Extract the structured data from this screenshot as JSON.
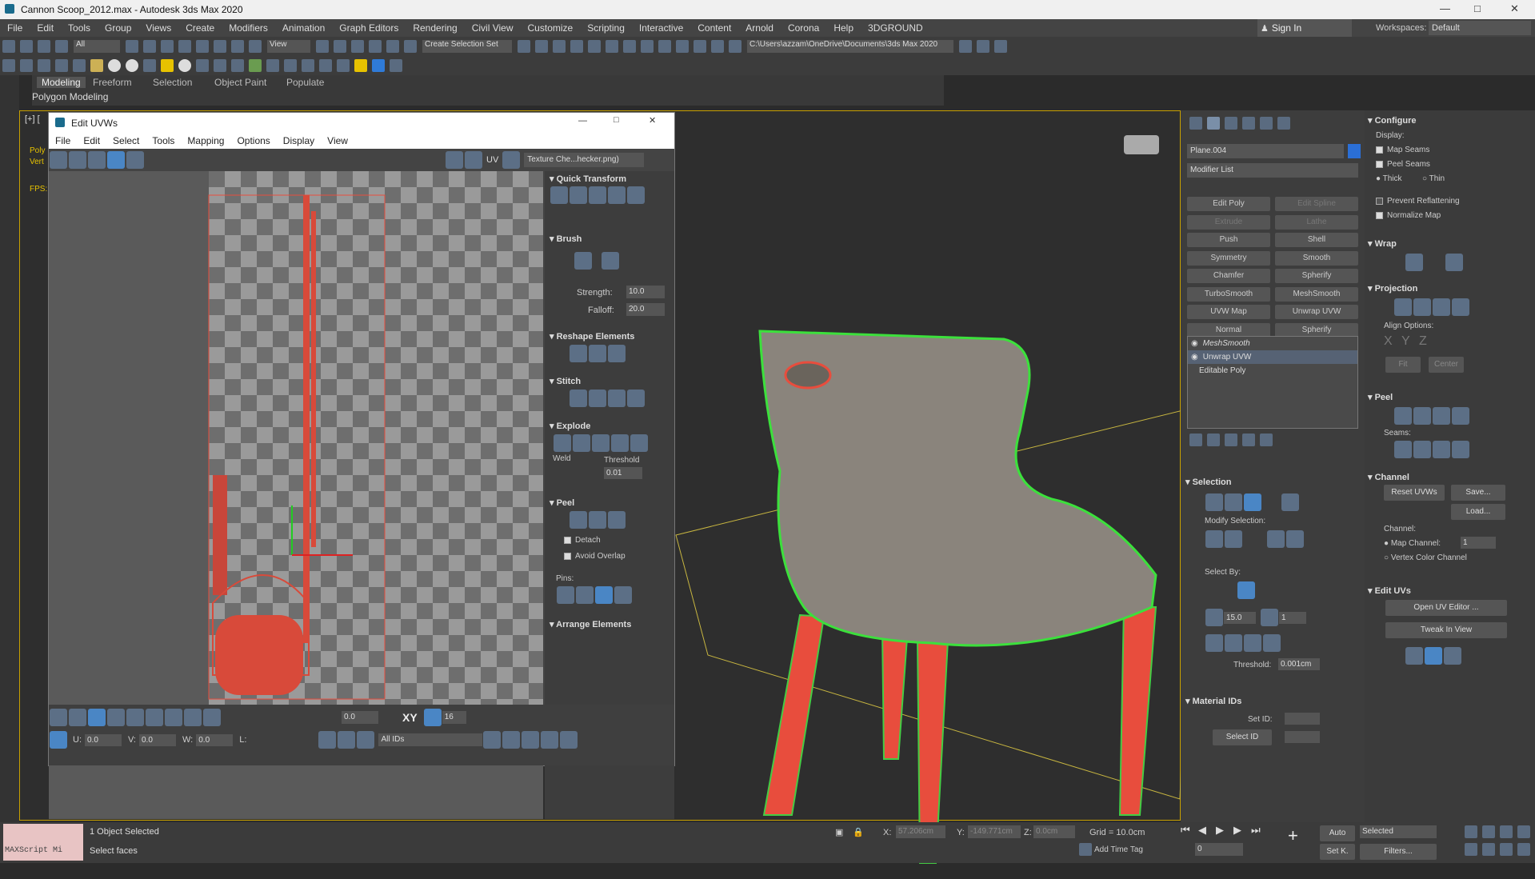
{
  "window": {
    "title": "Cannon Scoop_2012.max - Autodesk 3ds Max 2020"
  },
  "menu": [
    "File",
    "Edit",
    "Tools",
    "Group",
    "Views",
    "Create",
    "Modifiers",
    "Animation",
    "Graph Editors",
    "Rendering",
    "Civil View",
    "Customize",
    "Scripting",
    "Interactive",
    "Content",
    "Arnold",
    "Corona",
    "Help",
    "3DGROUND"
  ],
  "account": {
    "signin": "Sign In",
    "workspaces_label": "Workspaces:",
    "workspace": "Default"
  },
  "toolbar": {
    "filter": "All",
    "view_dropdown": "View",
    "selection_set": "Create Selection Set",
    "path": "C:\\Users\\azzam\\OneDrive\\Documents\\3ds Max 2020"
  },
  "ribbon": {
    "tabs": [
      "Modeling",
      "Freeform",
      "Selection",
      "Object Paint",
      "Populate"
    ],
    "subtitle": "Polygon Modeling"
  },
  "viewport": {
    "label": "[+] [",
    "left_labels": [
      "Poly",
      "Vert",
      "FPS:"
    ]
  },
  "uv_editor": {
    "title": "Edit UVWs",
    "menu": [
      "File",
      "Edit",
      "Select",
      "Tools",
      "Mapping",
      "Options",
      "Display",
      "View"
    ],
    "texture_dropdown": "Texture Che...hecker.png)",
    "uv_label": "UV",
    "sections": {
      "quick_transform": "Quick Transform",
      "brush": "Brush",
      "strength_label": "Strength:",
      "strength_value": "10.0",
      "falloff_label": "Falloff:",
      "falloff_value": "20.0",
      "reshape": "Reshape Elements",
      "stitch": "Stitch",
      "explode": "Explode",
      "weld": "Weld",
      "threshold_label": "Threshold",
      "threshold_value": "0.01",
      "peel": "Peel",
      "detach": "Detach",
      "avoid_overlap": "Avoid Overlap",
      "pins": "Pins:",
      "arrange": "Arrange Elements"
    },
    "bottom": {
      "angle_value": "0.0",
      "xy_label": "XY",
      "grid_value": "16",
      "u_label": "U:",
      "u_value": "0.0",
      "v_label": "V:",
      "v_value": "0.0",
      "w_label": "W:",
      "w_value": "0.0",
      "l_label": "L:",
      "ids": "All IDs"
    }
  },
  "command_panel": {
    "object_name": "Plane.004",
    "modifier_list": "Modifier List",
    "modifier_buttons": [
      "Edit Poly",
      "Edit Spline",
      "Extrude",
      "Lathe",
      "Push",
      "Shell",
      "Symmetry",
      "Smooth",
      "Chamfer",
      "Spherify",
      "TurboSmooth",
      "MeshSmooth",
      "UVW Map",
      "Unwrap UVW",
      "Normal",
      "Spherify"
    ],
    "stack": [
      "MeshSmooth",
      "Unwrap UVW",
      "Editable Poly"
    ],
    "selection": {
      "title": "Selection",
      "modify": "Modify Selection:",
      "select_by": "Select By:",
      "angle_value": "15.0",
      "count_value": "1",
      "threshold_label": "Threshold:",
      "threshold_value": "0.001cm"
    },
    "material_ids": {
      "title": "Material IDs",
      "set_id": "Set ID:",
      "select_id": "Select ID"
    }
  },
  "right_panel": {
    "configure": "Configure",
    "display": "Display:",
    "map_seams": "Map Seams",
    "peel_seams": "Peel Seams",
    "thick": "Thick",
    "thin": "Thin",
    "prevent_reflattening": "Prevent Reflattening",
    "normalize_map": "Normalize Map",
    "wrap": "Wrap",
    "projection": "Projection",
    "align_options": "Align Options:",
    "align_axes": [
      "X",
      "Y",
      "Z"
    ],
    "fit": "Fit",
    "center": "Center",
    "peel": "Peel",
    "seams": "Seams:",
    "channel": "Channel",
    "reset_uvws": "Reset UVWs",
    "save": "Save...",
    "load": "Load...",
    "channel_label": "Channel:",
    "map_channel": "Map Channel:",
    "map_channel_value": "1",
    "vertex_color_channel": "Vertex Color Channel",
    "edit_uvs": "Edit UVs",
    "open_uv_editor": "Open UV Editor ...",
    "tweak_in_view": "Tweak In View"
  },
  "status": {
    "maxscript": "MAXScript Mi",
    "objects_selected": "1 Object Selected",
    "prompt": "Select faces",
    "x_label": "X:",
    "x_value": "57.206cm",
    "y_label": "Y:",
    "y_value": "-149.771cm",
    "z_label": "Z:",
    "z_value": "0.0cm",
    "grid": "Grid = 10.0cm",
    "add_time_tag": "Add Time Tag",
    "auto": "Auto",
    "set_k": "Set K.",
    "selected": "Selected",
    "frame": "0",
    "filters": "Filters..."
  }
}
